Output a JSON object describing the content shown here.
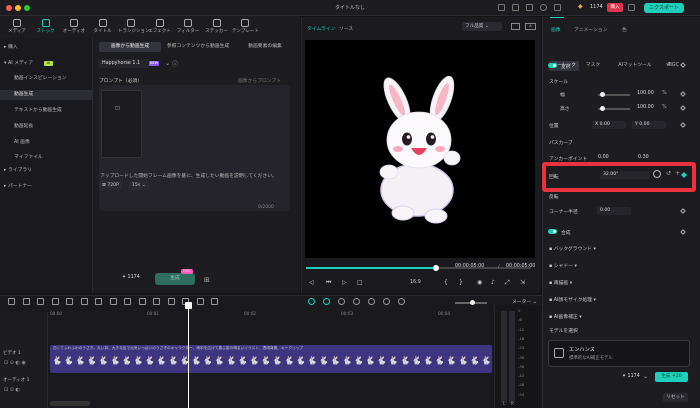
{
  "app": {
    "title": "タイトルなし"
  },
  "header": {
    "credits": "1174",
    "buy_label": "購入",
    "export_label": "エクスポート"
  },
  "toolbar": {
    "items": [
      {
        "label": "メディア",
        "icon": "media-icon"
      },
      {
        "label": "ストック",
        "icon": "stock-icon",
        "active": true
      },
      {
        "label": "オーディオ",
        "icon": "audio-icon"
      },
      {
        "label": "タイトル",
        "icon": "title-icon"
      },
      {
        "label": "トランジション",
        "icon": "transition-icon"
      },
      {
        "label": "エフェクト",
        "icon": "effect-icon"
      },
      {
        "label": "フィルター",
        "icon": "filter-icon"
      },
      {
        "label": "ステッカー",
        "icon": "sticker-icon"
      },
      {
        "label": "テンプレート",
        "icon": "template-icon"
      }
    ]
  },
  "sidebar": {
    "items": [
      {
        "label": "購入"
      },
      {
        "label": "AI メディア"
      },
      {
        "label": "動画インスピレーション"
      },
      {
        "label": "動画生成"
      },
      {
        "label": "テキストから動画生成"
      },
      {
        "label": "動画延長"
      },
      {
        "label": "AI 画像"
      },
      {
        "label": "マイファイル"
      },
      {
        "label": "ライブラリ"
      },
      {
        "label": "パートナー"
      }
    ],
    "ai_badge": "AI"
  },
  "panel": {
    "tabs": [
      "画像から動画生成",
      "参照コンテンツから動画生成",
      "動画要素の編集"
    ],
    "model": "Happyhorse 1.1",
    "new_badge": "NEW",
    "prompt_label": "プロンプト（必須）",
    "reference_prompt": "画像からプロンプト",
    "hint": "アップロードした開始フレーム画像を基に、生成したい動画を説明してください。",
    "counter": "0/2000",
    "resolution": "720P",
    "duration": "15s",
    "gen_credits": "1174",
    "gen_label": "生成",
    "hot_badge": "HOT"
  },
  "preview": {
    "tabs": [
      "タイムライン",
      "ソース"
    ],
    "quality": "フル品質",
    "time_current": "00:00:05:00",
    "time_total": "00:00:05:00",
    "aspect": "16:9"
  },
  "inspector": {
    "tabs": [
      "画像",
      "アニメーション",
      "色"
    ],
    "subtabs": [
      "ベーシック",
      "マスク",
      "AIマットツール",
      "AIGC"
    ],
    "transform_label": "変形",
    "scale_label": "スケール",
    "width_label": "幅",
    "width_value": "100.00",
    "height_label": "高さ",
    "height_value": "100.00",
    "position_label": "位置",
    "pos_x": "0.00",
    "pos_y": "0.00",
    "path_label": "パスカーブ",
    "anchor_label": "アンカーポイント",
    "anchor_x": "0.00",
    "anchor_y": "0.30",
    "rotation_label": "回転",
    "rotation_value": "32.00°",
    "flip_label": "反転",
    "corner_label": "コーナー半径",
    "corner_value": "0.00",
    "composite_label": "合成",
    "background_label": "バックグラウンド",
    "shadow_label": "シャドー",
    "stroke_label": "再描画",
    "mosaic_label": "AI顔モザイク処理",
    "enhance_label": "AI画像補正",
    "model_select": "モデルを選択",
    "enhance_title": "エンハンス",
    "enhance_desc": "標準的なAI補正モデル",
    "credits": "1174",
    "gen_label": "生成 ✦20",
    "reset_label": "リセット"
  },
  "timeline": {
    "meter_label": "メーター",
    "ruler": [
      "00:00",
      "00:01",
      "00:02",
      "00:03",
      "00:04"
    ],
    "clip_title": "白くてふわふわのうさぎ。丸い耳、大きな目で元気いっぱいのうさぎのキャラクター、両手を広げて喜ぶ姿の明るいイラスト、透明背景、キークリップ",
    "video_track": "ビデオ 1",
    "audio_track": "オーディオ 1",
    "db_labels": [
      "0",
      "-6",
      "-12",
      "-18",
      "-24",
      "-30",
      "-36",
      "-42",
      "-48",
      "-54"
    ]
  },
  "colors": {
    "accent": "#1ed0bb",
    "highlight": "#e8323c",
    "clip": "#3f3480"
  }
}
